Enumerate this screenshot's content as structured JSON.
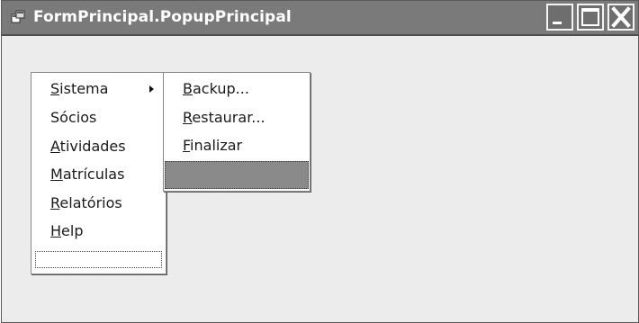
{
  "window": {
    "title": "FormPrincipal.PopupPrincipal",
    "icon": "app-form-icon",
    "buttons": [
      "minimize",
      "maximize",
      "close"
    ]
  },
  "main_menu": {
    "items": [
      {
        "accel": "S",
        "rest": "istema",
        "has_submenu": true
      },
      {
        "accel": "",
        "rest": "Sócios"
      },
      {
        "accel": "A",
        "rest": "tividades"
      },
      {
        "accel": "M",
        "rest": "atrículas"
      },
      {
        "accel": "R",
        "rest": "elatórios"
      },
      {
        "accel": "H",
        "rest": "elp"
      },
      {
        "accel": "",
        "rest": "",
        "empty": true
      }
    ]
  },
  "submenu_sistema": {
    "items": [
      {
        "accel": "B",
        "rest": "ackup..."
      },
      {
        "accel": "R",
        "rest": "estaurar..."
      },
      {
        "accel": "F",
        "rest": "inalizar"
      },
      {
        "accel": "",
        "rest": "",
        "empty": true,
        "selected": true
      }
    ]
  },
  "colors": {
    "titlebar": "#7a7a7a",
    "client": "#ececec",
    "menu_bg": "#ffffff",
    "selection": "#8a8a8a"
  }
}
